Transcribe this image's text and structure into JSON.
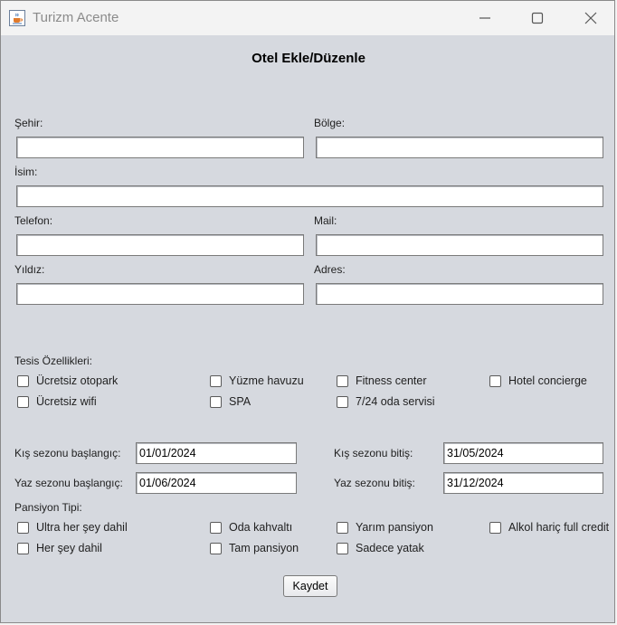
{
  "window": {
    "title": "Turizm Acente",
    "icon": "java-cup-icon"
  },
  "form": {
    "title": "Otel Ekle/Düzenle",
    "city_label": "Şehir:",
    "city_value": "",
    "region_label": "Bölge:",
    "region_value": "",
    "name_label": "İsim:",
    "name_value": "",
    "phone_label": "Telefon:",
    "phone_value": "",
    "mail_label": "Mail:",
    "mail_value": "",
    "star_label": "Yıldız:",
    "star_value": "",
    "address_label": "Adres:",
    "address_value": ""
  },
  "facilities": {
    "label": "Tesis Özellikleri:",
    "items": [
      {
        "label": "Ücretsiz otopark",
        "checked": false
      },
      {
        "label": "Yüzme havuzu",
        "checked": false
      },
      {
        "label": "Fitness center",
        "checked": false
      },
      {
        "label": "Hotel concierge",
        "checked": false
      },
      {
        "label": "Ücretsiz wifi",
        "checked": false
      },
      {
        "label": "SPA",
        "checked": false
      },
      {
        "label": "7/24 oda servisi",
        "checked": false
      }
    ]
  },
  "seasons": {
    "winter_start_label": "Kış sezonu başlangıç:",
    "winter_start_value": "01/01/2024",
    "winter_end_label": "Kış sezonu bitiş:",
    "winter_end_value": "31/05/2024",
    "summer_start_label": "Yaz sezonu başlangıç:",
    "summer_start_value": "01/06/2024",
    "summer_end_label": "Yaz sezonu bitiş:",
    "summer_end_value": "31/12/2024"
  },
  "pension": {
    "label": "Pansiyon Tipi:",
    "items": [
      {
        "label": "Ultra her şey dahil",
        "checked": false
      },
      {
        "label": "Oda kahvaltı",
        "checked": false
      },
      {
        "label": "Yarım pansiyon",
        "checked": false
      },
      {
        "label": "Alkol hariç full credit",
        "checked": false
      },
      {
        "label": "Her şey dahil",
        "checked": false
      },
      {
        "label": "Tam pansiyon",
        "checked": false
      },
      {
        "label": "Sadece yatak",
        "checked": false
      }
    ]
  },
  "actions": {
    "save_label": "Kaydet"
  }
}
